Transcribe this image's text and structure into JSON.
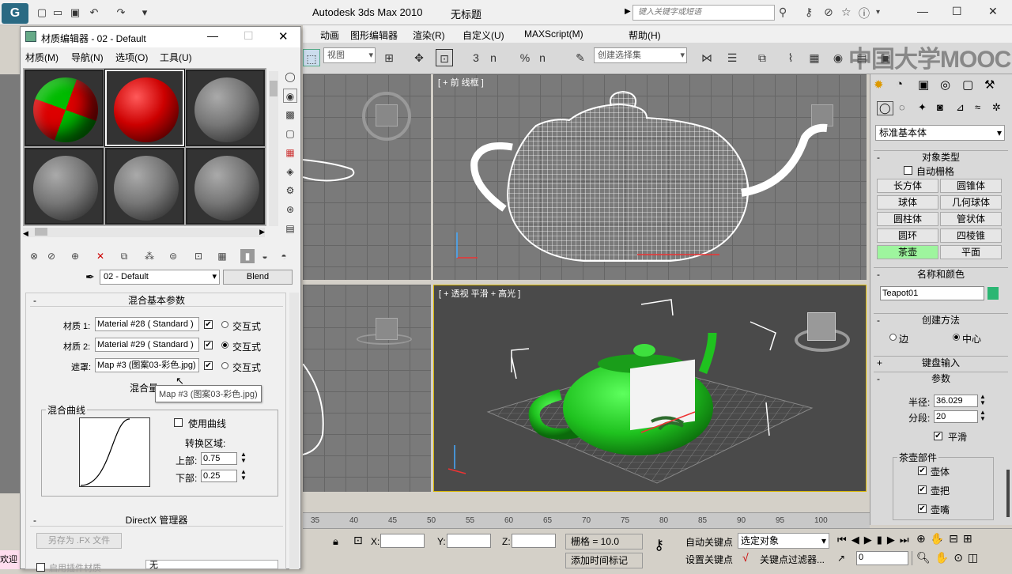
{
  "app": {
    "title": "Autodesk 3ds Max  2010",
    "document": "无标题",
    "logo_text": "G",
    "search_placeholder": "键入关键字或短语"
  },
  "main_menu": [
    "动画",
    "图形编辑器",
    "渲染(R)",
    "自定义(U)",
    "MAXScript(M)",
    "帮助(H)"
  ],
  "toolbar": {
    "view_dropdown": "视图",
    "selection_set": "创建选择集",
    "snap_labels": [
      "3",
      "n",
      "%",
      "n"
    ]
  },
  "watermark": "中国大学MOOC",
  "viewports": {
    "front": "[ + 前 线框 ]",
    "perspective": "[ + 透视  平滑 + 高光 ]"
  },
  "command_panel": {
    "category": "标准基本体",
    "object_type_header": "对象类型",
    "autogrid": "自动栅格",
    "objects": [
      "长方体",
      "圆锥体",
      "球体",
      "几何球体",
      "圆柱体",
      "管状体",
      "圆环",
      "四棱锥",
      "茶壶",
      "平面"
    ],
    "active_object": "茶壶",
    "name_color_header": "名称和颜色",
    "object_name": "Teapot01",
    "object_color": "#2bb673",
    "creation_method_header": "创建方法",
    "edge": "边",
    "center": "中心",
    "keyboard_entry": "键盘输入",
    "params_header": "参数",
    "radius_label": "半径:",
    "radius": "36.029",
    "segments_label": "分段:",
    "segments": "20",
    "smooth": "平滑",
    "teapot_parts": "茶壶部件",
    "body": "壶体",
    "handle": "壶把",
    "spout": "壶嘴"
  },
  "timeline": {
    "ticks": [
      "35",
      "40",
      "45",
      "50",
      "55",
      "60",
      "65",
      "70",
      "75",
      "80",
      "85",
      "90",
      "95",
      "100"
    ]
  },
  "statusbar": {
    "x": "X:",
    "y": "Y:",
    "z": "Z:",
    "grid": "栅格 = 10.0",
    "auto_key": "自动关键点",
    "set_key": "设置关键点",
    "selected": "选定对象",
    "key_filters": "关键点过滤器...",
    "add_time_tag": "添加时间标记",
    "frame": "0",
    "left_text": "欢迎"
  },
  "material_editor": {
    "title": "材质编辑器 - 02 - Default",
    "menu": [
      "材质(M)",
      "导航(N)",
      "选项(O)",
      "工具(U)"
    ],
    "material_name": "02 - Default",
    "material_type": "Blend",
    "blend_params_header": "混合基本参数",
    "mat1_label": "材质 1:",
    "mat1": "Material #28  ( Standard )",
    "mat2_label": "材质 2:",
    "mat2": "Material #29  ( Standard )",
    "mask_label": "遮罩:",
    "mask": "Map #3 (图案03-彩色.jpg)",
    "interactive": "交互式",
    "mix_amount_label": "混合量",
    "tooltip": "Map #3 (图案03-彩色.jpg)",
    "mix_curve_header": "混合曲线",
    "use_curve": "使用曲线",
    "transition_zone": "转换区域:",
    "upper_label": "上部:",
    "upper": "0.75",
    "lower_label": "下部:",
    "lower": "0.25",
    "directx_header": "DirectX 管理器",
    "save_fx": "另存为 .FX 文件",
    "enable_plugin": "启用插件材质",
    "none": "无",
    "collapse": "-"
  }
}
